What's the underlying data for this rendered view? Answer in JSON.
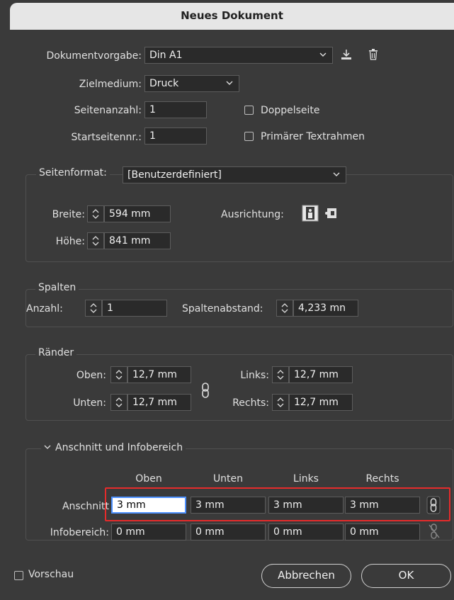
{
  "window": {
    "title": "Neues Dokument"
  },
  "top": {
    "preset_label": "Dokumentvorgabe:",
    "preset_value": "Din A1",
    "intent_label": "Zielmedium:",
    "intent_value": "Druck",
    "pages_label": "Seitenanzahl:",
    "pages_value": "1",
    "start_label": "Startseitennr.:",
    "start_value": "1",
    "facing_label": "Doppelseite",
    "primary_frame_label": "Primärer Textrahmen"
  },
  "page_size": {
    "legend": "Seitenformat:",
    "value": "[Benutzerdefiniert]",
    "width_label": "Breite:",
    "width_value": "594 mm",
    "height_label": "Höhe:",
    "height_value": "841 mm",
    "orientation_label": "Ausrichtung:"
  },
  "columns": {
    "legend": "Spalten",
    "count_label": "Anzahl:",
    "count_value": "1",
    "gutter_label": "Spaltenabstand:",
    "gutter_value": "4,233 mn"
  },
  "margins": {
    "legend": "Ränder",
    "top_label": "Oben:",
    "top_value": "12,7 mm",
    "bottom_label": "Unten:",
    "bottom_value": "12,7 mm",
    "left_label": "Links:",
    "left_value": "12,7 mm",
    "right_label": "Rechts:",
    "right_value": "12,7 mm"
  },
  "bleed": {
    "legend": "Anschnitt und Infobereich",
    "headers": [
      "Oben",
      "Unten",
      "Links",
      "Rechts"
    ],
    "bleed_label": "Anschnitt",
    "bleed_values": [
      "3 mm",
      "3 mm",
      "3 mm",
      "3 mm"
    ],
    "slug_label": "Infobereich:",
    "slug_values": [
      "0 mm",
      "0 mm",
      "0 mm",
      "0 mm"
    ]
  },
  "footer": {
    "preview_label": "Vorschau",
    "cancel_label": "Abbrechen",
    "ok_label": "OK"
  },
  "colors": {
    "highlight": "#e52b2b",
    "focus": "#4d90fe"
  }
}
